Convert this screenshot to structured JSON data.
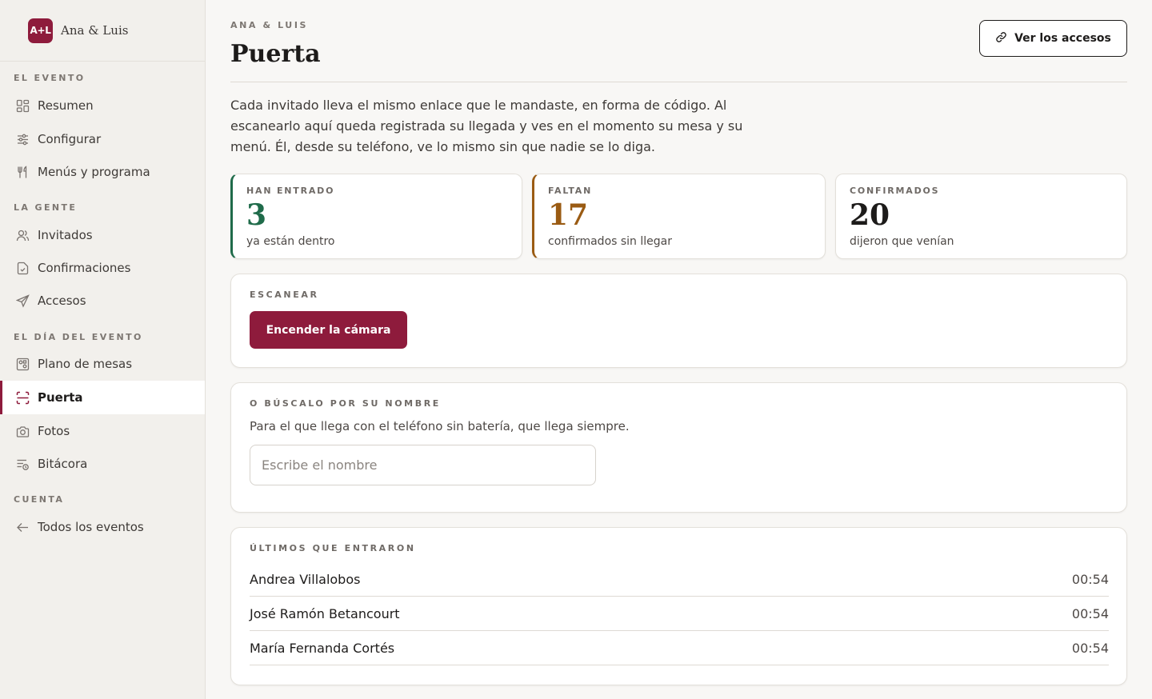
{
  "brand": {
    "logo_text": "A+L",
    "name": "Ana & Luis",
    "logo_color": "#8e1b3c"
  },
  "sidebar": {
    "sections": [
      {
        "title": "EL EVENTO",
        "items": [
          {
            "label": "Resumen",
            "icon": "grid-icon"
          },
          {
            "label": "Configurar",
            "icon": "sliders-icon"
          },
          {
            "label": "Menús y programa",
            "icon": "utensils-icon"
          }
        ]
      },
      {
        "title": "LA GENTE",
        "items": [
          {
            "label": "Invitados",
            "icon": "users-icon"
          },
          {
            "label": "Confirmaciones",
            "icon": "file-check-icon"
          },
          {
            "label": "Accesos",
            "icon": "send-icon"
          }
        ]
      },
      {
        "title": "EL DÍA DEL EVENTO",
        "items": [
          {
            "label": "Plano de mesas",
            "icon": "map-icon"
          },
          {
            "label": "Puerta",
            "icon": "scan-icon",
            "active": true
          },
          {
            "label": "Fotos",
            "icon": "camera-icon"
          },
          {
            "label": "Bitácora",
            "icon": "list-clock-icon"
          }
        ]
      },
      {
        "title": "CUENTA",
        "items": [
          {
            "label": "Todos los eventos",
            "icon": "arrow-left-icon"
          }
        ]
      }
    ]
  },
  "header": {
    "eyebrow": "ANA & LUIS",
    "title": "Puerta",
    "access_button": "Ver los accesos"
  },
  "intro": "Cada invitado lleva el mismo enlace que le mandaste, en forma de código. Al escanearlo aquí queda registrada su llegada y ves en el momento su mesa y su menú. Él, desde su teléfono, ve lo mismo sin que nadie se lo diga.",
  "stats": [
    {
      "label": "HAN ENTRADO",
      "value": "3",
      "sub": "ya están dentro",
      "color": "#1f6b4a"
    },
    {
      "label": "FALTAN",
      "value": "17",
      "sub": "confirmados sin llegar",
      "color": "#9a5b13"
    },
    {
      "label": "CONFIRMADOS",
      "value": "20",
      "sub": "dijeron que venían",
      "color": "#1d1b1a"
    }
  ],
  "scan": {
    "label": "ESCANEAR",
    "button": "Encender la cámara"
  },
  "search": {
    "label": "O BÚSCALO POR SU NOMBRE",
    "description": "Para el que llega con el teléfono sin batería, que llega siempre.",
    "placeholder": "Escribe el nombre"
  },
  "recent": {
    "label": "ÚLTIMOS QUE ENTRARON",
    "entries": [
      {
        "name": "Andrea Villalobos",
        "time": "00:54"
      },
      {
        "name": "José Ramón Betancourt",
        "time": "00:54"
      },
      {
        "name": "María Fernanda Cortés",
        "time": "00:54"
      }
    ]
  }
}
